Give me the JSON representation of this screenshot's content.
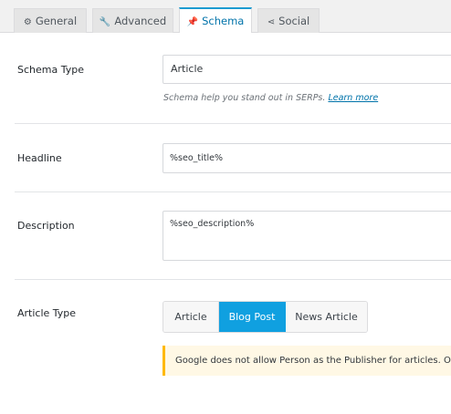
{
  "tabs": [
    {
      "label": "General",
      "icon": "gear-icon"
    },
    {
      "label": "Advanced",
      "icon": "wrench-icon"
    },
    {
      "label": "Schema",
      "icon": "pin-icon",
      "active": true
    },
    {
      "label": "Social",
      "icon": "share-icon"
    }
  ],
  "schema_type": {
    "label": "Schema Type",
    "value": "Article",
    "help_text": "Schema help you stand out in SERPs.",
    "help_link": "Learn more"
  },
  "headline": {
    "label": "Headline",
    "value": "%seo_title%"
  },
  "description": {
    "label": "Description",
    "value": "%seo_description%"
  },
  "article_type": {
    "label": "Article Type",
    "options": [
      "Article",
      "Blog Post",
      "News Article"
    ],
    "selected": "Blog Post"
  },
  "notice": {
    "text": "Google does not allow Person as the Publisher for articles. Organization will be used instead."
  },
  "colors": {
    "accent": "#10a0e0",
    "link": "#0073aa",
    "warning": "#ffb900"
  }
}
